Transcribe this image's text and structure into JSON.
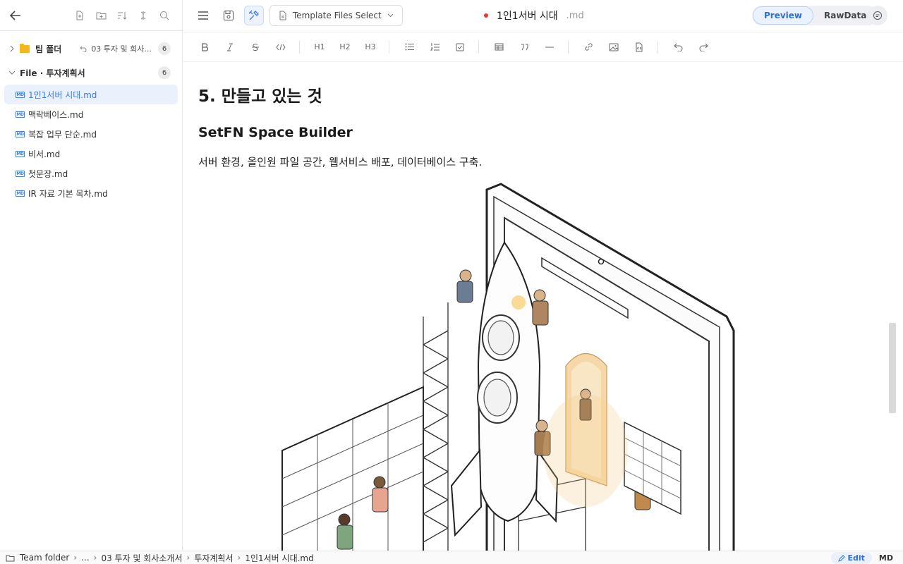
{
  "sidebar": {
    "groups": [
      {
        "title": "팀 폴더",
        "sub": "03 투자 및 회사...",
        "count": "6",
        "expanded": false
      },
      {
        "title": "File · 투자계획서",
        "count": "6",
        "expanded": true
      }
    ],
    "files": [
      {
        "label": "1인1서버 시대.md",
        "active": true
      },
      {
        "label": "맥락베이스.md"
      },
      {
        "label": "복잡 업무 단순.md"
      },
      {
        "label": "비서.md"
      },
      {
        "label": "첫문장.md"
      },
      {
        "label": "IR 자료 기본 목차.md"
      }
    ]
  },
  "topbar": {
    "template_label": "Template Files Select",
    "doc_title": "1인1서버 시대",
    "doc_ext": ".md",
    "preview_label": "Preview",
    "rawdata_label": "RawData"
  },
  "toolbar": {
    "h1": "H1",
    "h2": "H2",
    "h3": "H3"
  },
  "document": {
    "h1": "5. 만들고 있는 것",
    "h2": "SetFN Space Builder",
    "paragraph": "서버 환경, 올인원 파일 공간, 웹서비스 배포, 데이터베이스 구축."
  },
  "status": {
    "crumbs": [
      "Team folder",
      "...",
      "03 투자 및 회사소개서",
      "투자계획서",
      "1인1서버 시대.md"
    ],
    "edit_label": "Edit",
    "format_label": "MD"
  },
  "colors": {
    "accent": "#2f6fd3",
    "folder": "#f2b81b",
    "unsaved": "#e53935"
  }
}
